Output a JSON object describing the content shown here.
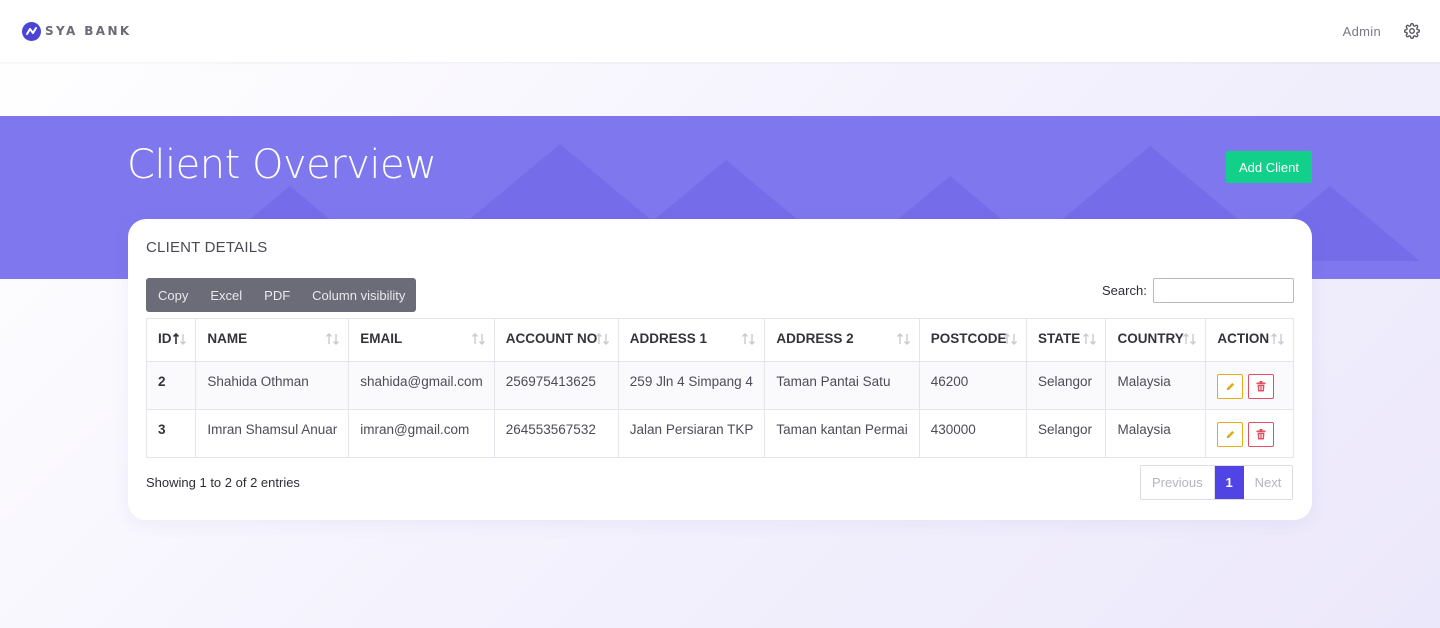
{
  "app": {
    "brand": "SYA BANK",
    "admin_label": "Admin"
  },
  "header": {
    "title": "Client Overview",
    "add_button": "Add Client"
  },
  "card": {
    "title": "CLIENT DETAILS",
    "export_buttons": [
      "Copy",
      "Excel",
      "PDF",
      "Column visibility"
    ],
    "search_label": "Search:",
    "search_value": ""
  },
  "table": {
    "columns": [
      "ID",
      "NAME",
      "EMAIL",
      "ACCOUNT NO",
      "ADDRESS 1",
      "ADDRESS 2",
      "POSTCODE",
      "STATE",
      "COUNTRY",
      "ACTION"
    ],
    "rows": [
      {
        "id": "2",
        "name": "Shahida Othman",
        "email": "shahida@gmail.com",
        "account_no": "256975413625",
        "address1": "259 Jln 4 Simpang 4",
        "address2": "Taman Pantai Satu",
        "postcode": "46200",
        "state": "Selangor",
        "country": "Malaysia"
      },
      {
        "id": "3",
        "name": "Imran Shamsul Anuar",
        "email": "imran@gmail.com",
        "account_no": "264553567532",
        "address1": "Jalan Persiaran TKP",
        "address2": "Taman kantan Permai",
        "postcode": "430000",
        "state": "Selangor",
        "country": "Malaysia"
      }
    ]
  },
  "footer": {
    "info": "Showing 1 to 2 of 2 entries",
    "previous": "Previous",
    "current_page": "1",
    "next": "Next"
  },
  "colors": {
    "brand": "#4b45d6",
    "hero": "#7f77ee",
    "add_button": "#12cf8a",
    "edit": "#e5ac1a",
    "delete": "#e05060",
    "page_active": "#5044e4"
  },
  "icons": {
    "logo": "brand-logo-icon",
    "settings": "gear-icon",
    "sort": "sort-arrows-icon",
    "edit": "pencil-icon",
    "delete": "trash-icon"
  }
}
